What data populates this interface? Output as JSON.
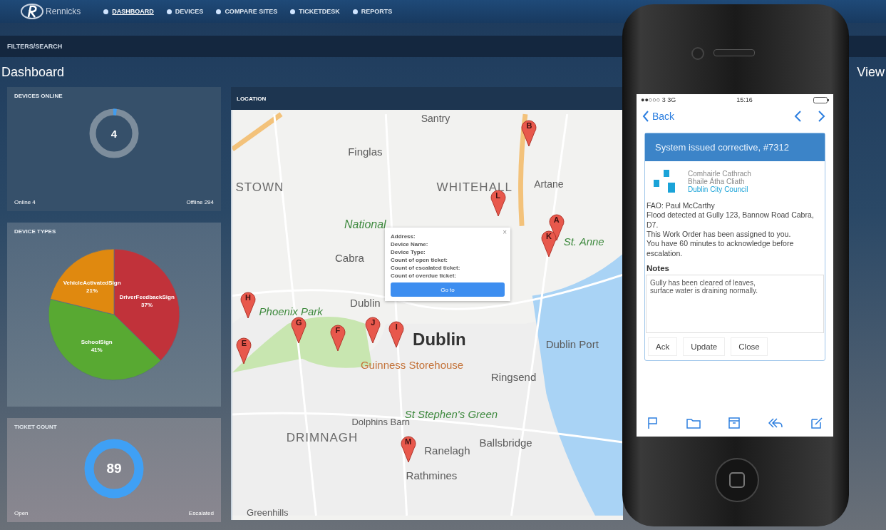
{
  "brand": "Rennicks",
  "nav": [
    {
      "label": "DASHBOARD",
      "selected": true
    },
    {
      "label": "DEVICES",
      "selected": false
    },
    {
      "label": "COMPARE SITES",
      "selected": false
    },
    {
      "label": "TICKETDESK",
      "selected": false
    },
    {
      "label": "REPORTS",
      "selected": false
    }
  ],
  "filters_label": "FILTERS/SEARCH",
  "page_title": "Dashboard",
  "right_title": "View",
  "devices_online": {
    "title": "DEVICES ONLINE",
    "count": "4",
    "level": 0.013,
    "online": "Online 4",
    "offline": "Offline 294"
  },
  "device_types": {
    "title": "DEVICE TYPES",
    "chart_data": {
      "type": "pie",
      "categories": [
        "DriverFeedbackSign",
        "SchoolSign",
        "VehicleActivatedSign"
      ],
      "values": [
        37,
        41,
        21
      ],
      "colors": [
        "#c1323a",
        "#58a932",
        "#e0890f"
      ],
      "data_labels": true,
      "value_labels": [
        "37%",
        "41%",
        "21%"
      ]
    }
  },
  "ticket_count": {
    "title": "TICKET COUNT",
    "count": "89",
    "open": "Open",
    "escalated": "Escalated"
  },
  "location": {
    "title": "LOCATION",
    "places": [
      {
        "name": "Santry"
      },
      {
        "name": "Finglas"
      },
      {
        "name": "STOWN"
      },
      {
        "name": "WHITEHALL"
      },
      {
        "name": "Artane"
      },
      {
        "name": "National"
      },
      {
        "name": "Cabra"
      },
      {
        "name": "St. Anne"
      },
      {
        "name": "Phoenix Park"
      },
      {
        "name": "Dublin"
      },
      {
        "name": "Dublin"
      },
      {
        "name": "Dublin Port"
      },
      {
        "name": "Guinness Storehouse"
      },
      {
        "name": "Ringsend"
      },
      {
        "name": "St Stephen's Green"
      },
      {
        "name": "Dolphins Barn"
      },
      {
        "name": "DRIMNAGH"
      },
      {
        "name": "Ballsbridge"
      },
      {
        "name": "Ranelagh"
      },
      {
        "name": "Rathmines"
      },
      {
        "name": "Greenhills"
      }
    ],
    "markers": [
      {
        "label": "B"
      },
      {
        "label": "L"
      },
      {
        "label": "A"
      },
      {
        "label": "K"
      },
      {
        "label": "H"
      },
      {
        "label": "J"
      },
      {
        "label": "I"
      },
      {
        "label": "G"
      },
      {
        "label": "F"
      },
      {
        "label": "E"
      },
      {
        "label": "M"
      }
    ],
    "popup": {
      "close": "×",
      "fields": [
        "Address:",
        "Device Name:",
        "Device Type:",
        "Count of open ticket:",
        "Count of escalated ticket:",
        "Count of overdue ticket:"
      ],
      "button": "Go to"
    }
  },
  "phone": {
    "carrier": "●●○○○ 3  3G",
    "time": "15:16",
    "back": "Back",
    "header": "System issued corrective, #7312",
    "org": [
      "Comhairle Cathrach",
      "Bhaile Átha Cliath",
      "Dublin City Council"
    ],
    "body": [
      "FAO: Paul McCarthy",
      "Flood detected at Gully 123, Bannow Road Cabra, D7.",
      "This Work Order has been assigned to you.",
      "You have 60 minutes to acknowledge before escalation."
    ],
    "notes_label": "Notes",
    "notes": "Gully has been cleared of leaves,\nsurface water is draining normally.",
    "buttons": [
      "Ack",
      "Update",
      "Close"
    ]
  }
}
